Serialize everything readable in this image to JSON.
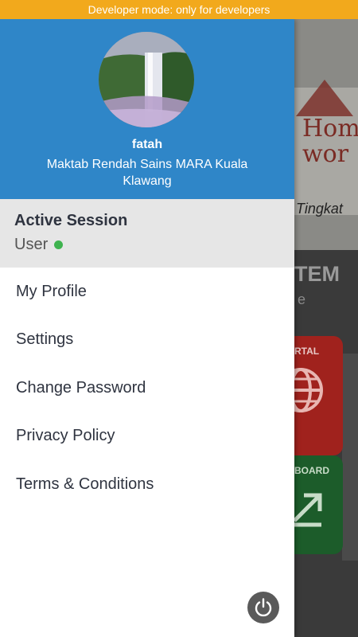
{
  "status_bar": {
    "developer_notice": "Developer mode: only for developers"
  },
  "drawer": {
    "user": {
      "name": "fatah",
      "school": "Maktab Rendah Sains MARA Kuala Klawang"
    },
    "session": {
      "title": "Active Session",
      "role": "User",
      "status_color": "#3fb34f"
    },
    "menu": [
      {
        "label": "My Profile"
      },
      {
        "label": "Settings"
      },
      {
        "label": "Change Password"
      },
      {
        "label": "Privacy Policy"
      },
      {
        "label": "Terms & Conditions"
      }
    ],
    "logout_icon": "power-icon",
    "header_color": "#2f86c8"
  },
  "background": {
    "banner_text_1": "Hom",
    "banner_text_2": "wor",
    "banner_caption": "Tingkat",
    "section_title": "TEM",
    "section_subtitle": "e",
    "card_portal": "RTAL",
    "card_dashboard": "BOARD"
  }
}
